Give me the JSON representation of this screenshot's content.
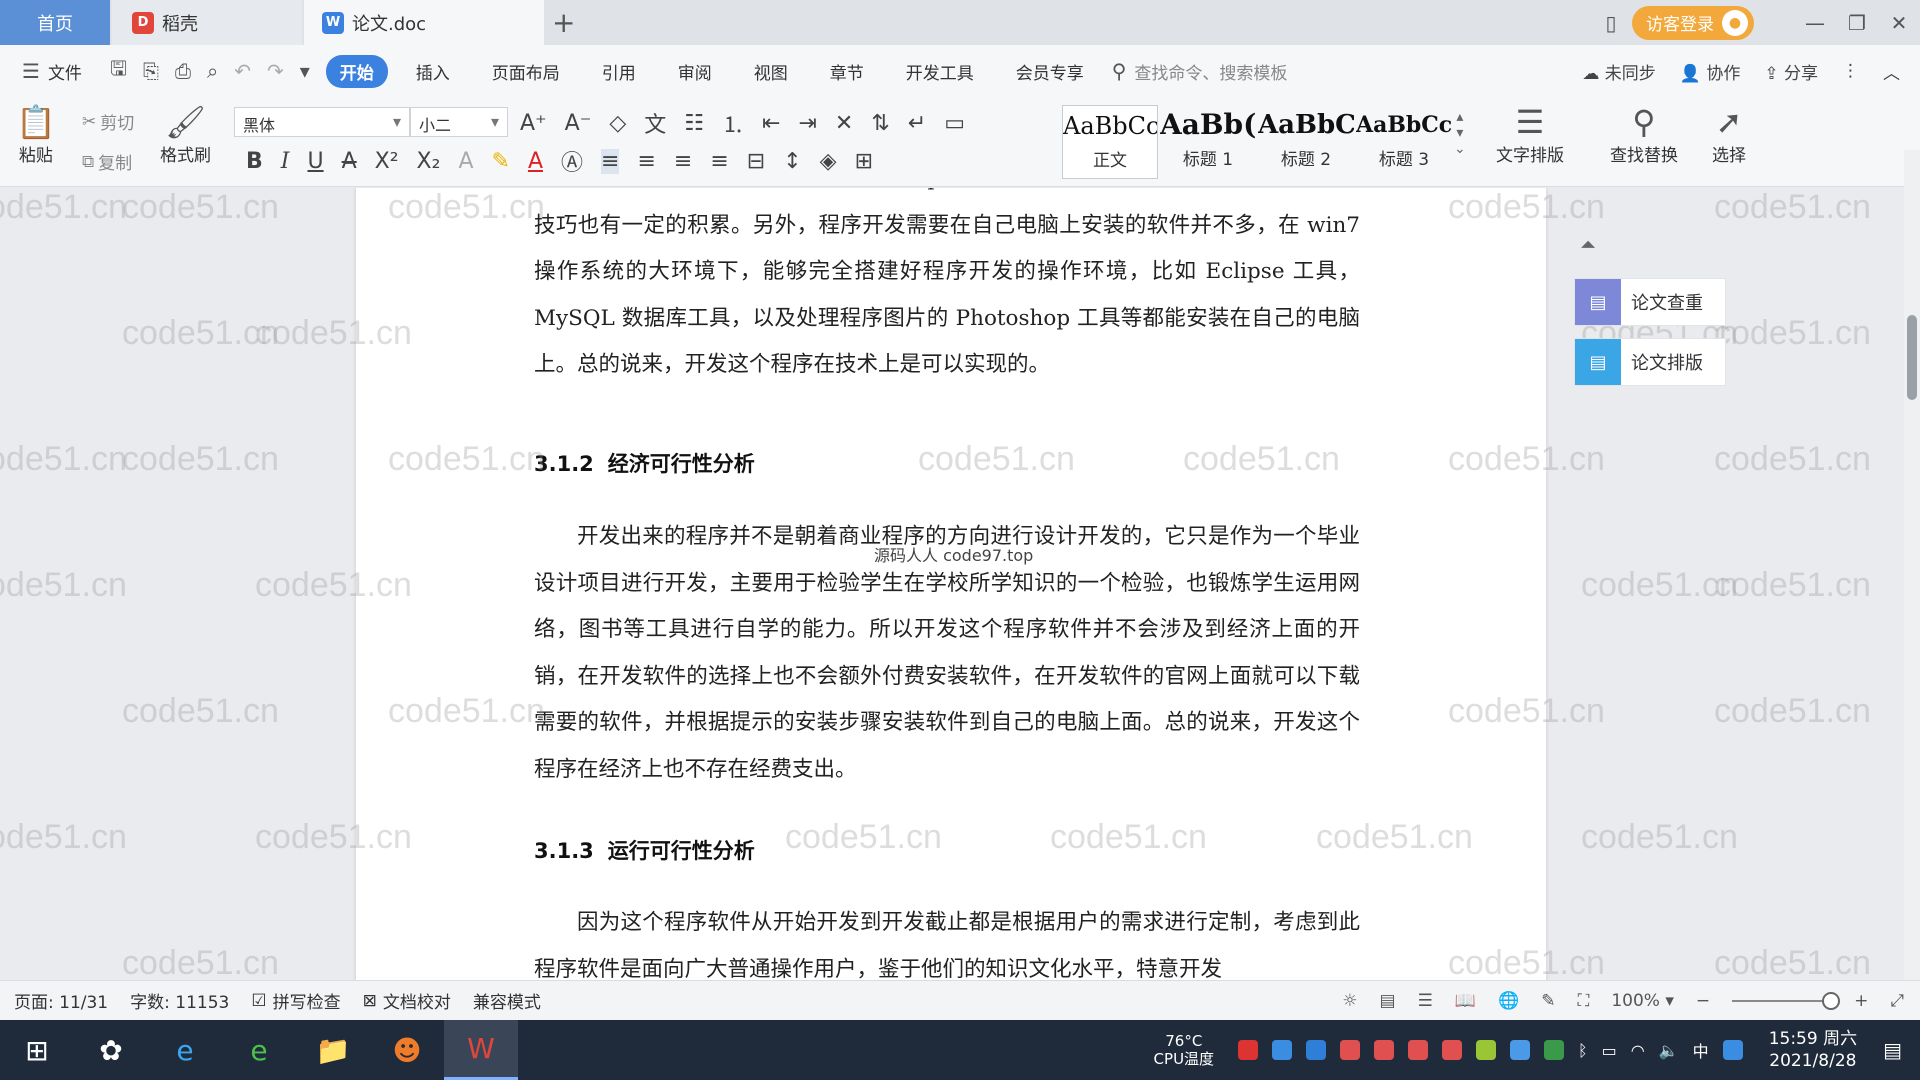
{
  "tabs": {
    "home": "首页",
    "daoke": "稻壳",
    "doc": "论文.doc",
    "add": "+"
  },
  "titlebar": {
    "login": "访客登录"
  },
  "menu": {
    "file": "文件",
    "items": [
      "开始",
      "插入",
      "页面布局",
      "引用",
      "审阅",
      "视图",
      "章节",
      "开发工具",
      "会员专享"
    ],
    "search_placeholder": "查找命令、搜索模板",
    "unsynced": "未同步",
    "collab": "协作",
    "share": "分享"
  },
  "ribbon": {
    "paste": "粘贴",
    "cut": "剪切",
    "copy": "复制",
    "format_painter": "格式刷",
    "font_name": "黑体",
    "font_size": "小二",
    "styles": [
      {
        "sample": "AaBbCcI",
        "name": "正文"
      },
      {
        "sample": "AaBb(",
        "name": "标题 1"
      },
      {
        "sample": "AaBbC",
        "name": "标题 2"
      },
      {
        "sample": "AaBbCcl",
        "name": "标题 3"
      }
    ],
    "text_layout": "文字排版",
    "find_replace": "查找替换",
    "select": "选择"
  },
  "document": {
    "para1": "的程序开发方面的设计作品，所以对 Eclipse 工具的使用比较熟练，对于数据库的操作技巧也有一定的积累。另外，程序开发需要在自己电脑上安装的软件并不多，在 win7 操作系统的大环境下，能够完全搭建好程序开发的操作环境，比如 Eclipse 工具，MySQL 数据库工具，以及处理程序图片的 Photoshop 工具等都能安装在自己的电脑上。总的说来，开发这个程序在技术上是可以实现的。",
    "h312_num": "3.1.2",
    "h312_title": "经济可行性分析",
    "para2": "开发出来的程序并不是朝着商业程序的方向进行设计开发的，它只是作为一个毕业设计项目进行开发，主要用于检验学生在学校所学知识的一个检验，也锻炼学生运用网络，图书等工具进行自学的能力。所以开发这个程序软件并不会涉及到经济上面的开销，在开发软件的选择上也不会额外付费安装软件，在开发软件的官网上面就可以下载需要的软件，并根据提示的安装步骤安装软件到自己的电脑上面。总的说来，开发这个程序在经济上也不存在经费支出。",
    "h313_num": "3.1.3",
    "h313_title": "运行可行性分析",
    "para3": "因为这个程序软件从开始开发到开发截止都是根据用户的需求进行定制，考虑到此程序软件是面向广大普通操作用户，鉴于他们的知识文化水平，特意开发",
    "overlay": "源码人人 code97.top",
    "watermark": "code51.cn"
  },
  "side_panel": {
    "check": "论文查重",
    "layout": "论文排版"
  },
  "status": {
    "page": "页面: 11/31",
    "words": "字数: 11153",
    "spell": "拼写检查",
    "proof": "文档校对",
    "compat": "兼容模式",
    "zoom": "100%"
  },
  "taskbar": {
    "cpu_temp": "76°C",
    "cpu_label": "CPU温度",
    "ime": "中",
    "time": "15:59 周六",
    "date": "2021/8/28"
  },
  "colors": {
    "accent": "#3b82e0",
    "home_tab": "#5b8fd6",
    "login": "#f2a83b",
    "taskbar": "#1f2a3a"
  }
}
